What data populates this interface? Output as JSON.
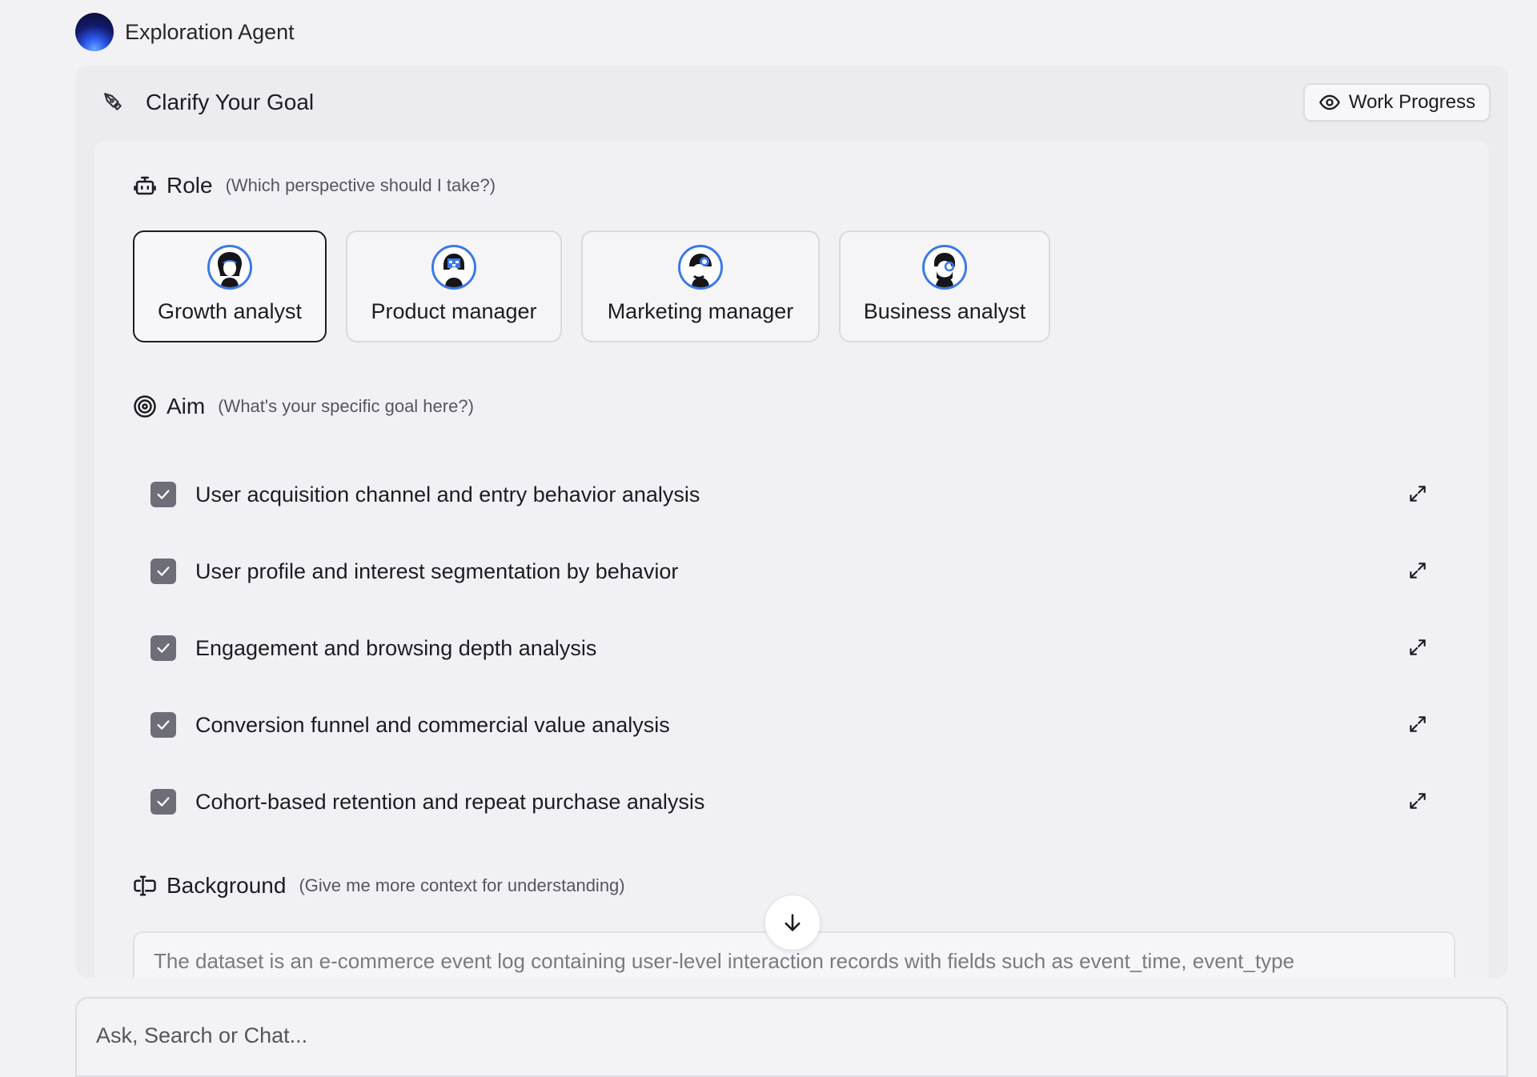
{
  "agent": {
    "name": "Exploration Agent"
  },
  "panel": {
    "title": "Clarify Your Goal",
    "work_progress_label": "Work Progress"
  },
  "role": {
    "title": "Role",
    "hint": "(Which perspective should I take?)",
    "options": [
      {
        "label": "Growth analyst",
        "selected": true
      },
      {
        "label": "Product manager",
        "selected": false
      },
      {
        "label": "Marketing manager",
        "selected": false
      },
      {
        "label": "Business analyst",
        "selected": false
      }
    ]
  },
  "aim": {
    "title": "Aim",
    "hint": "(What's your specific goal here?)",
    "items": [
      {
        "label": "User acquisition channel and entry behavior analysis",
        "checked": true
      },
      {
        "label": "User profile and interest segmentation by behavior",
        "checked": true
      },
      {
        "label": "Engagement and browsing depth analysis",
        "checked": true
      },
      {
        "label": "Conversion funnel and commercial value analysis",
        "checked": true
      },
      {
        "label": "Cohort-based retention and repeat purchase analysis",
        "checked": true
      }
    ]
  },
  "background": {
    "title": "Background",
    "hint": "(Give me more context for understanding)",
    "text": "The dataset is an e-commerce event log containing user-level interaction records with fields such as event_time, event_type"
  },
  "chat": {
    "placeholder": "Ask, Search or Chat..."
  },
  "colors": {
    "accent": "#3a78e8",
    "checkbox": "#6e6e78",
    "selected_border": "#1c1c22"
  }
}
